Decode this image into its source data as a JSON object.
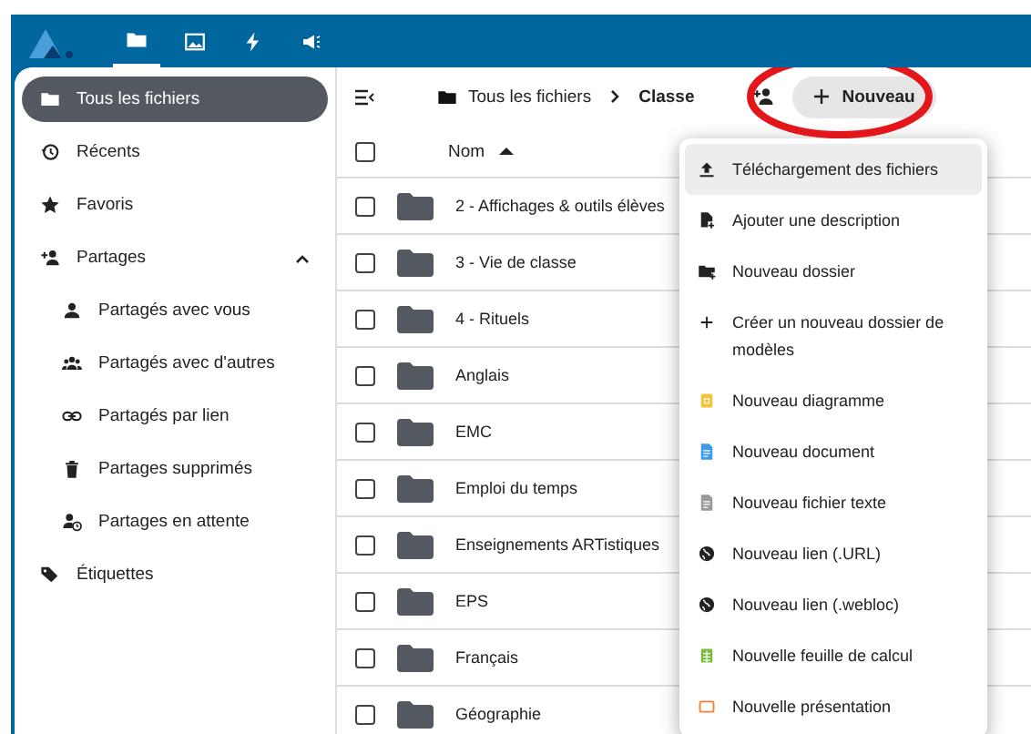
{
  "header": {
    "apps": [
      {
        "kind": "files",
        "selected": true
      },
      {
        "kind": "photos",
        "selected": false
      },
      {
        "kind": "activity",
        "selected": false
      },
      {
        "kind": "announcements",
        "selected": false
      }
    ]
  },
  "sidebar": {
    "items": [
      {
        "kind": "folder",
        "label": "Tous les fichiers",
        "selected": true
      },
      {
        "kind": "recent",
        "label": "Récents",
        "selected": false
      },
      {
        "kind": "star",
        "label": "Favoris",
        "selected": false
      },
      {
        "kind": "share",
        "label": "Partages",
        "selected": false,
        "expanded": true,
        "children": [
          {
            "kind": "person",
            "label": "Partagés avec vous",
            "selected": false
          },
          {
            "kind": "group",
            "label": "Partagés avec d'autres",
            "selected": false
          },
          {
            "kind": "link",
            "label": "Partagés par lien",
            "selected": false
          },
          {
            "kind": "trash",
            "label": "Partages supprimés",
            "selected": false
          },
          {
            "kind": "pending",
            "label": "Partages en attente",
            "selected": false
          }
        ]
      },
      {
        "kind": "tag",
        "label": "Étiquettes",
        "selected": false
      }
    ]
  },
  "toolbar": {
    "breadcrumbs": [
      "Tous les fichiers",
      "Classe"
    ],
    "new_button": "Nouveau",
    "annotation": {
      "kind": "ellipse"
    }
  },
  "table": {
    "select_all": {
      "checked": false
    },
    "columns": [
      {
        "label": "Nom"
      }
    ],
    "rows": [
      {
        "name": "2 - Affichages & outils élèves",
        "checked": false
      },
      {
        "name": "3 - Vie de classe",
        "checked": false
      },
      {
        "name": "4 - Rituels",
        "checked": false
      },
      {
        "name": "Anglais",
        "checked": false
      },
      {
        "name": "EMC",
        "checked": false
      },
      {
        "name": "Emploi du temps",
        "checked": false
      },
      {
        "name": "Enseignements ARTistiques",
        "checked": false
      },
      {
        "name": "EPS",
        "checked": false
      },
      {
        "name": "Français",
        "checked": false
      },
      {
        "name": "Géographie",
        "checked": false
      }
    ]
  },
  "new_menu": {
    "items": [
      {
        "kind": "upload",
        "label": "Téléchargement des fichiers",
        "selected": true
      },
      {
        "kind": "description",
        "label": "Ajouter une description",
        "selected": false
      },
      {
        "kind": "new-folder",
        "label": "Nouveau dossier",
        "selected": false
      },
      {
        "kind": "plus",
        "label": "Créer un nouveau dossier de modèles",
        "selected": false
      },
      {
        "kind": "diagram",
        "label": "Nouveau diagramme",
        "selected": false
      },
      {
        "kind": "document",
        "label": "Nouveau document",
        "selected": false
      },
      {
        "kind": "text",
        "label": "Nouveau fichier texte",
        "selected": false
      },
      {
        "kind": "globe",
        "label": "Nouveau lien (.URL)",
        "selected": false
      },
      {
        "kind": "globe",
        "label": "Nouveau lien (.webloc)",
        "selected": false
      },
      {
        "kind": "spreadsheet",
        "label": "Nouvelle feuille de calcul",
        "selected": false
      },
      {
        "kind": "presentation",
        "label": "Nouvelle présentation",
        "selected": false
      }
    ]
  }
}
